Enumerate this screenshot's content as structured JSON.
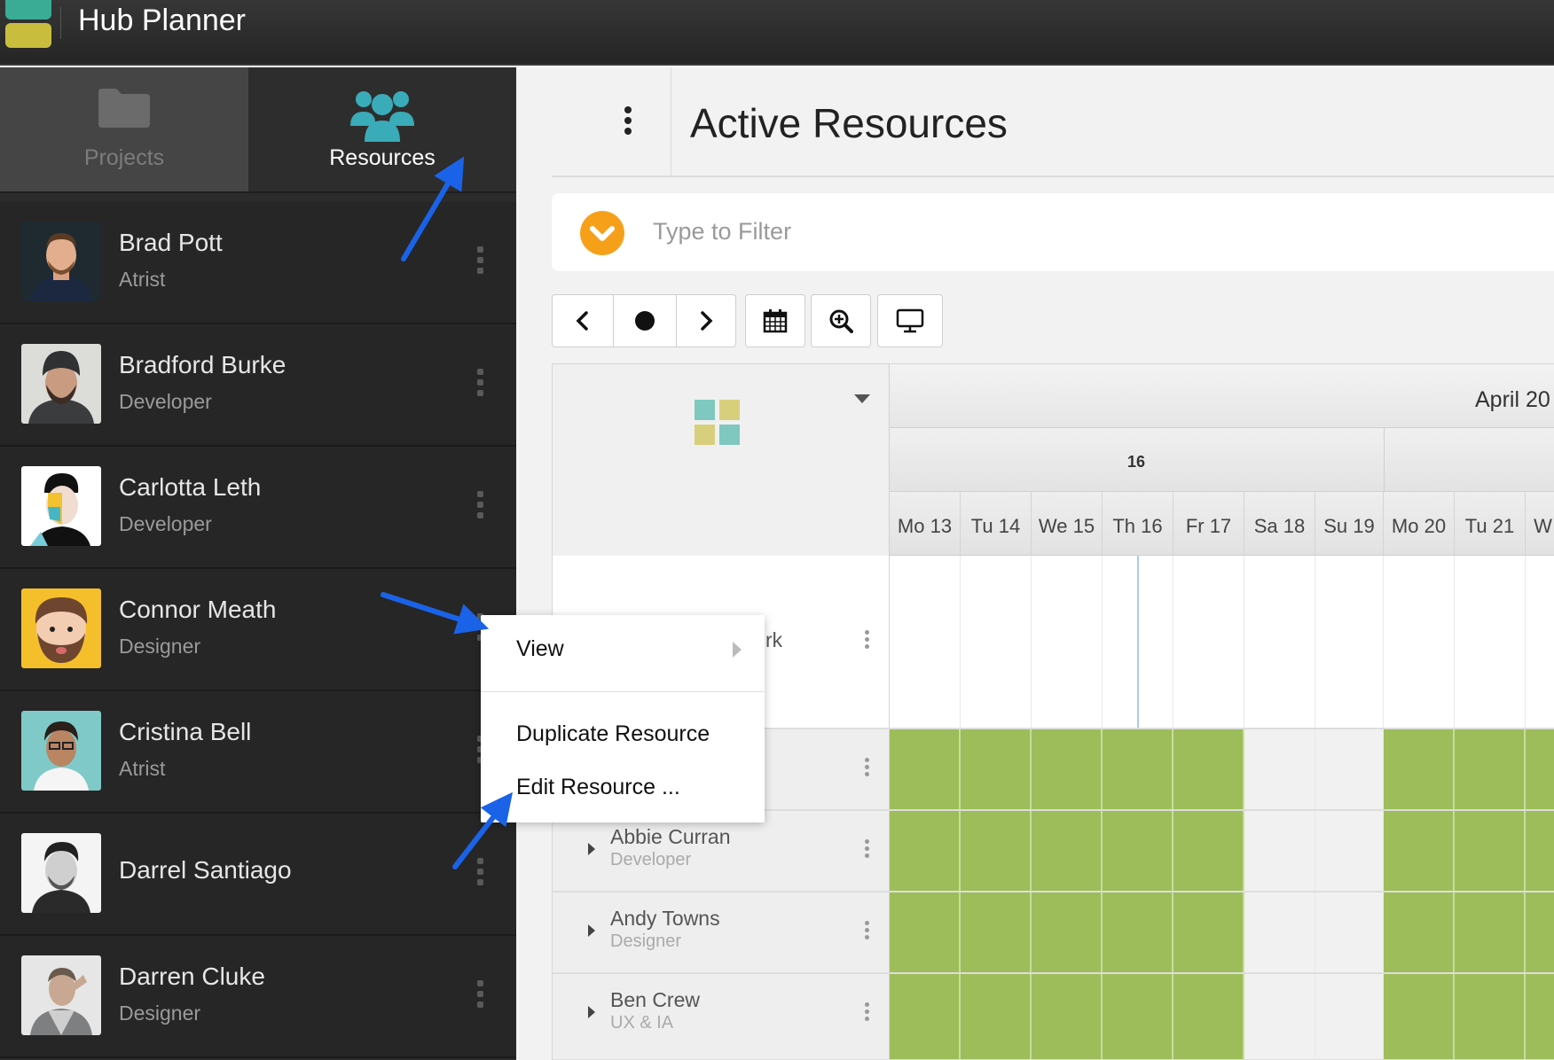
{
  "app": {
    "title": "Hub Planner"
  },
  "sidebar": {
    "tabs": [
      {
        "label": "Projects",
        "active": false,
        "icon": "folder-icon"
      },
      {
        "label": "Resources",
        "active": true,
        "icon": "users-icon"
      }
    ],
    "resources": [
      {
        "name": "Brad Pott",
        "role": "Atrist"
      },
      {
        "name": "Bradford Burke",
        "role": "Developer"
      },
      {
        "name": "Carlotta Leth",
        "role": "Developer"
      },
      {
        "name": "Connor Meath",
        "role": "Designer"
      },
      {
        "name": "Cristina Bell",
        "role": "Atrist"
      },
      {
        "name": "Darrel Santiago",
        "role": ""
      },
      {
        "name": "Darren Cluke",
        "role": "Designer"
      }
    ]
  },
  "main": {
    "title": "Active Resources",
    "filter": {
      "placeholder": "Type to Filter"
    },
    "toolbar": [
      "previous-icon",
      "today-icon",
      "next-icon",
      "calendar-icon",
      "zoom-in-icon",
      "monitor-icon"
    ]
  },
  "schedule": {
    "month_label": "April 20",
    "week_label": "16",
    "days": [
      "Mo 13",
      "Tu 14",
      "We 15",
      "Th 16",
      "Fr 17",
      "Sa 18",
      "Su 19",
      "Mo 20",
      "Tu 21",
      "W"
    ],
    "partial_row_text": "rk",
    "rows": [
      {
        "name": "Abbie Curran",
        "role": "Developer"
      },
      {
        "name": "Andy Towns",
        "role": "Designer"
      },
      {
        "name": "Ben Crew",
        "role": "UX & IA"
      }
    ],
    "colors": {
      "busy": "#9dbd5a",
      "accent": "#f6a01a",
      "brand_teal": "#3aabb8"
    }
  },
  "context_menu": {
    "items": [
      {
        "label": "View",
        "has_submenu": true
      },
      {
        "label": "Duplicate Resource"
      },
      {
        "label": "Edit Resource ..."
      }
    ]
  },
  "annotation_color": "#1a63e8"
}
